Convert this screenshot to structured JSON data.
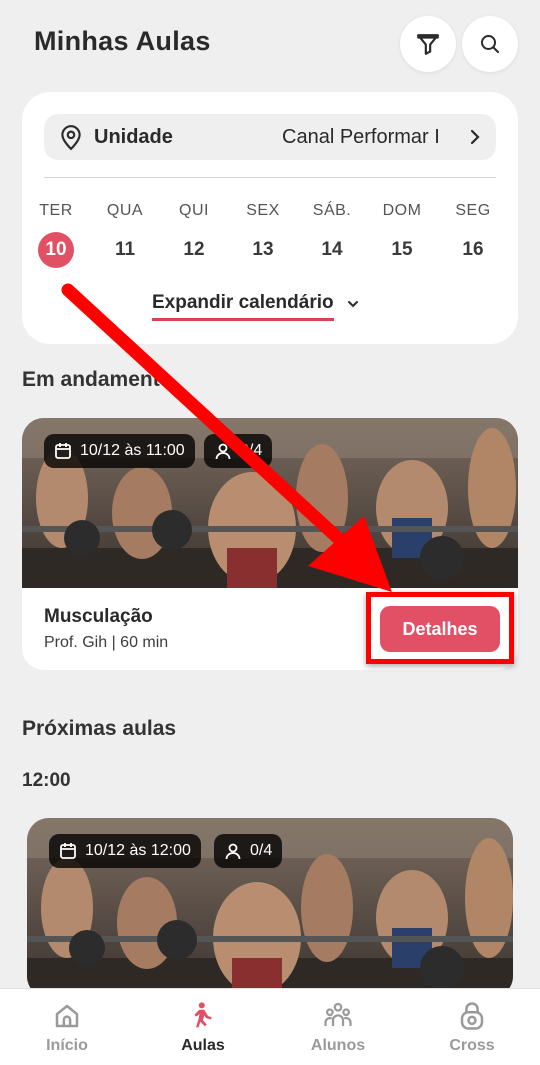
{
  "header": {
    "title": "Minhas Aulas",
    "filter_icon": "filter-icon",
    "search_icon": "search-icon"
  },
  "calendar": {
    "unit_label": "Unidade",
    "unit_value": "Canal Performar I",
    "days": [
      {
        "name": "TER",
        "num": "10",
        "selected": true
      },
      {
        "name": "QUA",
        "num": "11"
      },
      {
        "name": "QUI",
        "num": "12"
      },
      {
        "name": "SEX",
        "num": "13"
      },
      {
        "name": "SÁB.",
        "num": "14"
      },
      {
        "name": "DOM",
        "num": "15"
      },
      {
        "name": "SEG",
        "num": "16"
      }
    ],
    "expand_label": "Expandir calendário"
  },
  "in_progress": {
    "title": "Em andamento",
    "card": {
      "datetime": "10/12 às 11:00",
      "capacity": "0/4",
      "name": "Musculação",
      "meta": "Prof. Gih | 60 min",
      "details_label": "Detalhes"
    }
  },
  "upcoming": {
    "title": "Próximas aulas",
    "time": "12:00",
    "card": {
      "datetime": "10/12 às 12:00",
      "capacity": "0/4"
    }
  },
  "nav": {
    "items": [
      {
        "label": "Início",
        "icon": "home-icon"
      },
      {
        "label": "Aulas",
        "icon": "exercise-icon",
        "active": true
      },
      {
        "label": "Alunos",
        "icon": "students-icon"
      },
      {
        "label": "Cross",
        "icon": "kettlebell-icon"
      }
    ]
  },
  "colors": {
    "accent": "#e15064",
    "annotation": "#ff0000",
    "background": "#efefef"
  }
}
